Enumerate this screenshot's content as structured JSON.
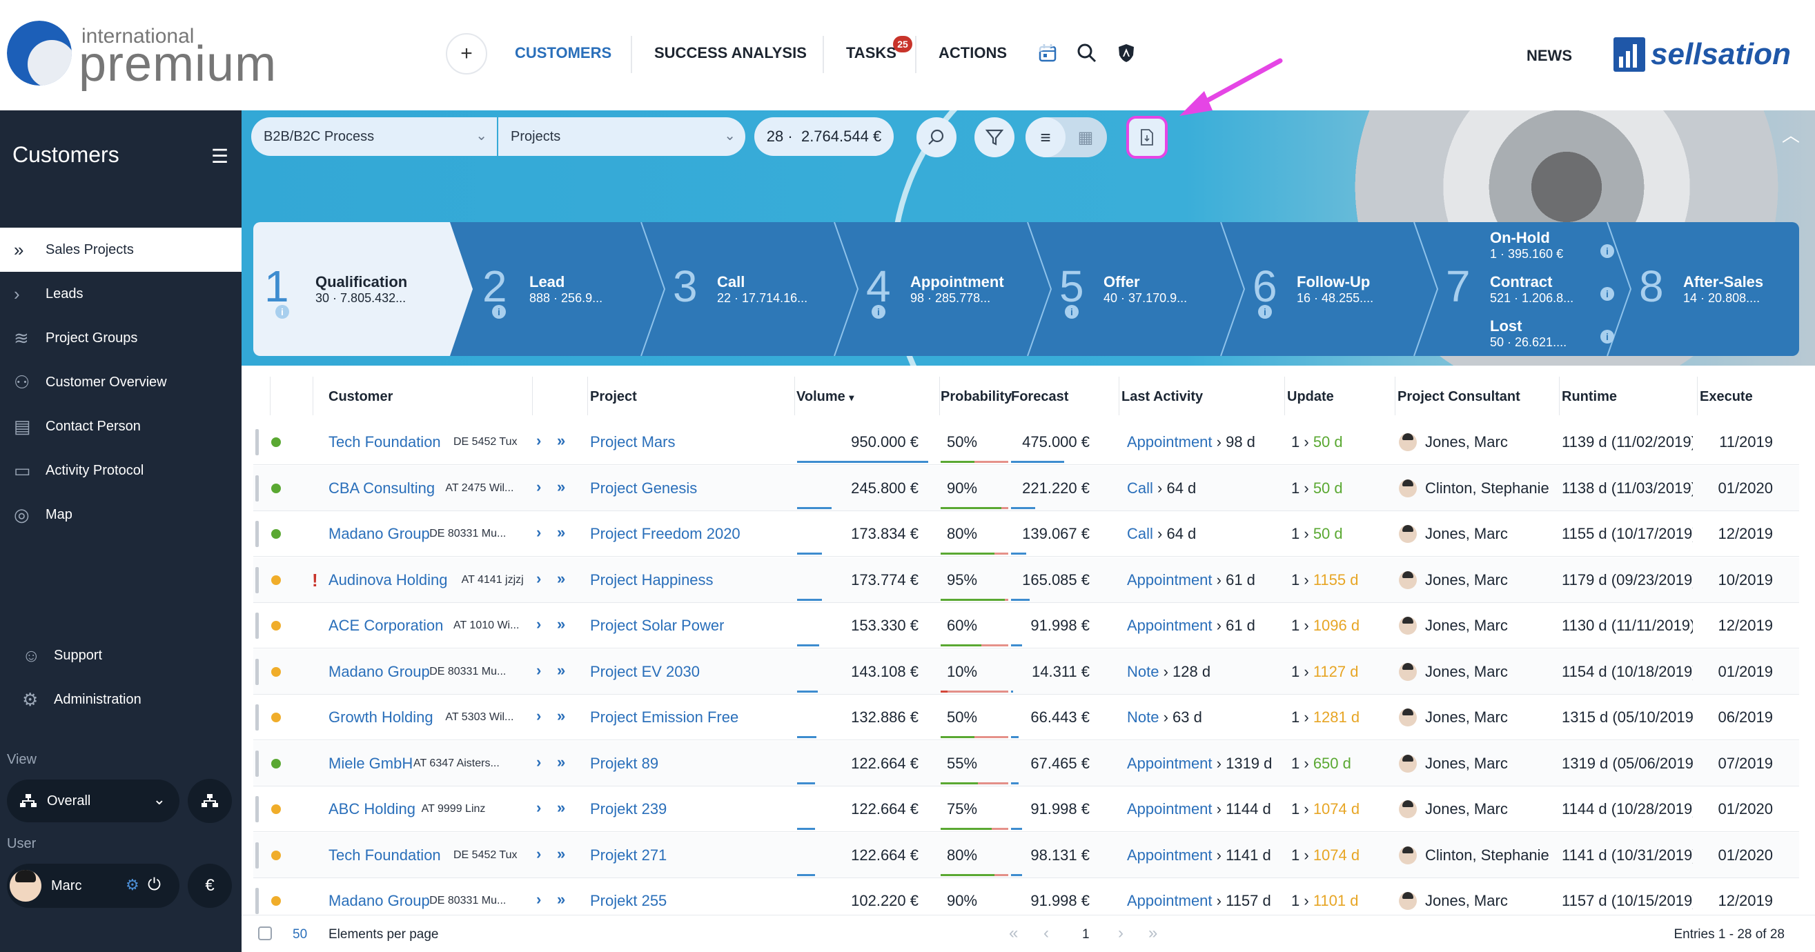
{
  "brand": {
    "logo_small": "international",
    "logo_big": "premium",
    "partner": "sellsation"
  },
  "topnav": {
    "plus": "+",
    "customers": "CUSTOMERS",
    "success": "SUCCESS ANALYSIS",
    "tasks": "TASKS",
    "tasks_badge": "25",
    "actions": "ACTIONS",
    "news": "NEWS",
    "accent_color": "#2a6fba"
  },
  "sidebar": {
    "title": "Customers",
    "items": [
      {
        "label": "Sales Projects",
        "icon": "double-chevron-icon"
      },
      {
        "label": "Leads",
        "icon": "chevron-icon"
      },
      {
        "label": "Project Groups",
        "icon": "layers-icon"
      },
      {
        "label": "Customer Overview",
        "icon": "users-icon"
      },
      {
        "label": "Contact Person",
        "icon": "contact-card-icon"
      },
      {
        "label": "Activity Protocol",
        "icon": "protocol-icon"
      },
      {
        "label": "Map",
        "icon": "globe-icon"
      }
    ],
    "support": "Support",
    "administration": "Administration",
    "view_label": "View",
    "view_value": "Overall",
    "user_label": "User",
    "user_name": "Marc",
    "currency": "€"
  },
  "filters": {
    "process": "B2B/B2C Process",
    "type": "Projects",
    "count": "28 ·",
    "total": "2.764.544 €"
  },
  "stages": [
    {
      "num": "1",
      "name": "Qualification",
      "count": "30 ·",
      "value": "7.805.432..."
    },
    {
      "num": "2",
      "name": "Lead",
      "count": "888 ·",
      "value": "256.9..."
    },
    {
      "num": "3",
      "name": "Call",
      "count": "22 ·",
      "value": "17.714.16..."
    },
    {
      "num": "4",
      "name": "Appointment",
      "count": "98 ·",
      "value": "285.778..."
    },
    {
      "num": "5",
      "name": "Offer",
      "count": "40 ·",
      "value": "37.170.9..."
    },
    {
      "num": "6",
      "name": "Follow-Up",
      "count": "16 ·",
      "value": "48.255...."
    },
    {
      "num": "7",
      "onhold": "On-Hold",
      "onhold_sub": "1 ·  395.160 €",
      "name": "Contract",
      "count": "521 ·",
      "value": "1.206.8...",
      "lost": "Lost",
      "lost_sub": "50 ·  26.621...."
    },
    {
      "num": "8",
      "name": "After-Sales",
      "count": "14 ·",
      "value": "20.808...."
    }
  ],
  "table": {
    "headers": {
      "customer": "Customer",
      "project": "Project",
      "volume": "Volume",
      "probability": "Probability",
      "forecast": "Forecast",
      "last_activity": "Last Activity",
      "update": "Update",
      "consultant": "Project Consultant",
      "runtime": "Runtime",
      "execute": "Execute"
    },
    "rows": [
      {
        "status": "green",
        "warn": "",
        "customer": "Tech Foundation",
        "loc": "DE 5452 Tux",
        "project": "Project Mars",
        "volume": "950.000 €",
        "prob": "50%",
        "forecast": "475.000 €",
        "act": "Appointment",
        "actd": "98 d",
        "upd1": "1",
        "upd2": "50 d",
        "updcolor": "#5aa832",
        "consultant": "Jones, Marc",
        "runtime": "1139 d (11/02/2019)",
        "execute": "11/2019",
        "volbar": 0.95,
        "probbar": 0.5,
        "fcbar": 0.48
      },
      {
        "status": "green",
        "warn": "",
        "customer": "CBA Consulting",
        "loc": "AT 2475 Wil...",
        "project": "Project Genesis",
        "volume": "245.800 €",
        "prob": "90%",
        "forecast": "221.220 €",
        "act": "Call",
        "actd": "64 d",
        "upd1": "1",
        "upd2": "50 d",
        "updcolor": "#5aa832",
        "consultant": "Clinton, Stephanie",
        "runtime": "1138 d (11/03/2019)",
        "execute": "01/2020",
        "volbar": 0.25,
        "probbar": 0.9,
        "fcbar": 0.22
      },
      {
        "status": "green",
        "warn": "",
        "customer": "Madano Group",
        "loc": "DE 80331 Mu...",
        "project": "Project Freedom 2020",
        "volume": "173.834 €",
        "prob": "80%",
        "forecast": "139.067 €",
        "act": "Call",
        "actd": "64 d",
        "upd1": "1",
        "upd2": "50 d",
        "updcolor": "#5aa832",
        "consultant": "Jones, Marc",
        "runtime": "1155 d (10/17/2019)",
        "execute": "12/2019",
        "volbar": 0.18,
        "probbar": 0.8,
        "fcbar": 0.14
      },
      {
        "status": "orange",
        "warn": "!",
        "customer": "Audinova Holding",
        "loc": "AT 4141 jzjzj",
        "project": "Project Happiness",
        "volume": "173.774 €",
        "prob": "95%",
        "forecast": "165.085 €",
        "act": "Appointment",
        "actd": "61 d",
        "upd1": "1",
        "upd2": "1155 d",
        "updcolor": "#e7a524",
        "consultant": "Jones, Marc",
        "runtime": "1179 d (09/23/2019)",
        "execute": "10/2019",
        "volbar": 0.18,
        "probbar": 0.95,
        "fcbar": 0.17
      },
      {
        "status": "orange",
        "warn": "",
        "customer": "ACE Corporation",
        "loc": "AT 1010 Wi...",
        "project": "Project Solar Power",
        "volume": "153.330 €",
        "prob": "60%",
        "forecast": "91.998 €",
        "act": "Appointment",
        "actd": "61 d",
        "upd1": "1",
        "upd2": "1096 d",
        "updcolor": "#e7a524",
        "consultant": "Jones, Marc",
        "runtime": "1130 d (11/11/2019)",
        "execute": "12/2019",
        "volbar": 0.16,
        "probbar": 0.6,
        "fcbar": 0.1
      },
      {
        "status": "orange",
        "warn": "",
        "customer": "Madano Group",
        "loc": "DE 80331 Mu...",
        "project": "Project EV 2030",
        "volume": "143.108 €",
        "prob": "10%",
        "forecast": "14.311 €",
        "act": "Note",
        "actd": "128 d",
        "upd1": "1",
        "upd2": "1127 d",
        "updcolor": "#e7a524",
        "consultant": "Jones, Marc",
        "runtime": "1154 d (10/18/2019)",
        "execute": "01/2019",
        "volbar": 0.15,
        "probbar": 0.1,
        "fcbar": 0.02
      },
      {
        "status": "orange",
        "warn": "",
        "customer": "Growth Holding",
        "loc": "AT 5303 Wil...",
        "project": "Project Emission Free",
        "volume": "132.886 €",
        "prob": "50%",
        "forecast": "66.443 €",
        "act": "Note",
        "actd": "63 d",
        "upd1": "1",
        "upd2": "1281 d",
        "updcolor": "#e7a524",
        "consultant": "Jones, Marc",
        "runtime": "1315 d (05/10/2019)",
        "execute": "06/2019",
        "volbar": 0.14,
        "probbar": 0.5,
        "fcbar": 0.07
      },
      {
        "status": "green",
        "warn": "",
        "customer": "Miele GmbH",
        "loc": "AT 6347 Aisters...",
        "project": "Projekt 89",
        "volume": "122.664 €",
        "prob": "55%",
        "forecast": "67.465 €",
        "act": "Appointment",
        "actd": "1319 d",
        "upd1": "1",
        "upd2": "650 d",
        "updcolor": "#5aa832",
        "consultant": "Jones, Marc",
        "runtime": "1319 d (05/06/2019",
        "execute": "07/2019",
        "volbar": 0.13,
        "probbar": 0.55,
        "fcbar": 0.07
      },
      {
        "status": "orange",
        "warn": "",
        "customer": "ABC Holding",
        "loc": "AT 9999 Linz",
        "project": "Projekt 239",
        "volume": "122.664 €",
        "prob": "75%",
        "forecast": "91.998 €",
        "act": "Appointment",
        "actd": "1144 d",
        "upd1": "1",
        "upd2": "1074 d",
        "updcolor": "#e7a524",
        "consultant": "Jones, Marc",
        "runtime": "1144 d (10/28/2019)",
        "execute": "01/2020",
        "volbar": 0.13,
        "probbar": 0.75,
        "fcbar": 0.1
      },
      {
        "status": "orange",
        "warn": "",
        "customer": "Tech Foundation",
        "loc": "DE 5452 Tux",
        "project": "Projekt 271",
        "volume": "122.664 €",
        "prob": "80%",
        "forecast": "98.131 €",
        "act": "Appointment",
        "actd": "1141 d",
        "upd1": "1",
        "upd2": "1074 d",
        "updcolor": "#e7a524",
        "consultant": "Clinton, Stephanie",
        "runtime": "1141 d (10/31/2019)",
        "execute": "01/2020",
        "volbar": 0.13,
        "probbar": 0.8,
        "fcbar": 0.1
      },
      {
        "status": "orange",
        "warn": "",
        "customer": "Madano Group",
        "loc": "DE 80331 Mu...",
        "project": "Projekt 255",
        "volume": "102.220 €",
        "prob": "90%",
        "forecast": "91.998 €",
        "act": "Appointment",
        "actd": "1157 d",
        "upd1": "1",
        "upd2": "1101 d",
        "updcolor": "#e7a524",
        "consultant": "Jones, Marc",
        "runtime": "1157 d (10/15/2019)",
        "execute": "12/2019",
        "volbar": 0.11,
        "probbar": 0.9,
        "fcbar": 0.1
      }
    ]
  },
  "footer": {
    "per_page": "50",
    "per_page_label": "Elements per page",
    "page": "1",
    "entries": "Entries 1 - 28 of 28"
  },
  "colors": {
    "green": "#5aa832",
    "orange": "#f0ad2a",
    "highlight": "#e545e5"
  }
}
